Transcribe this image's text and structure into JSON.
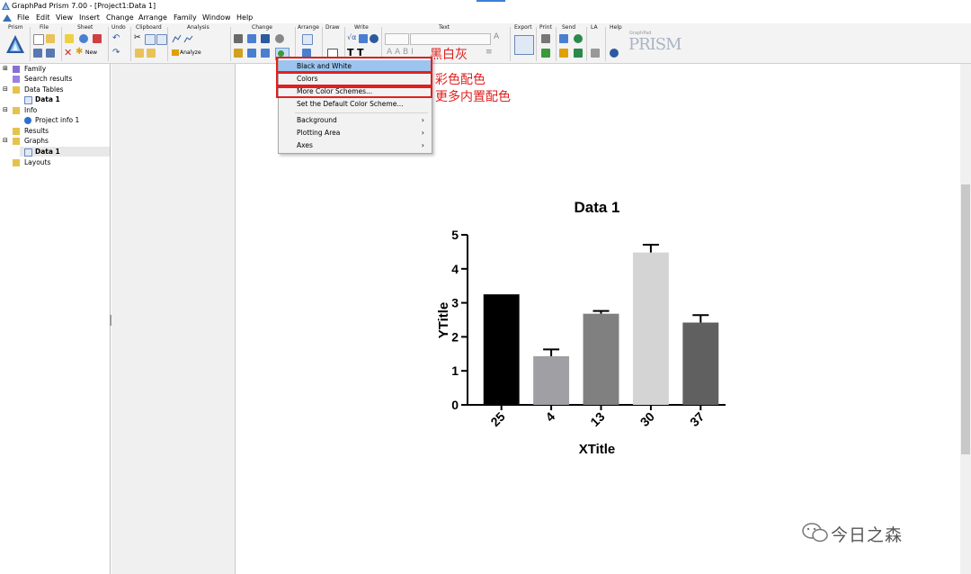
{
  "window": {
    "title": "GraphPad Prism 7.00 - [Project1:Data 1]"
  },
  "menubar": [
    "File",
    "Edit",
    "View",
    "Insert",
    "Change",
    "Arrange",
    "Family",
    "Window",
    "Help"
  ],
  "ribbon": {
    "groups": [
      "Prism",
      "File",
      "Sheet",
      "Undo",
      "Clipboard",
      "Analysis",
      "Change",
      "Arrange",
      "Draw",
      "Write",
      "Text",
      "Export",
      "Print",
      "Send",
      "LA",
      "Help"
    ],
    "new_label": "New",
    "analyze_label": "Analyze",
    "brand": "PRISM",
    "brand_small": "GraphPad"
  },
  "tree": {
    "items": [
      {
        "label": "Family",
        "icon": "family-icon"
      },
      {
        "label": "Search results",
        "icon": "search-results-icon"
      },
      {
        "label": "Data Tables",
        "icon": "folder-icon"
      },
      {
        "label": "Data 1",
        "icon": "data-table-icon"
      },
      {
        "label": "Info",
        "icon": "folder-icon"
      },
      {
        "label": "Project info 1",
        "icon": "info-icon"
      },
      {
        "label": "Results",
        "icon": "folder-icon"
      },
      {
        "label": "Graphs",
        "icon": "folder-icon"
      },
      {
        "label": "Data 1",
        "icon": "graph-icon"
      },
      {
        "label": "Layouts",
        "icon": "folder-icon"
      }
    ]
  },
  "color_menu": {
    "items": [
      {
        "label": "Black and White",
        "submenu": false
      },
      {
        "label": "Colors",
        "submenu": false
      },
      {
        "label": "More Color Schemes...",
        "submenu": false
      },
      {
        "label": "Set the Default Color Scheme...",
        "submenu": false
      },
      {
        "label": "Background",
        "submenu": true
      },
      {
        "label": "Plotting Area",
        "submenu": true
      },
      {
        "label": "Axes",
        "submenu": true
      }
    ],
    "highlighted": "Black and White"
  },
  "annotations": [
    "黑白灰",
    "彩色配色",
    "更多内置配色"
  ],
  "annotation_color": "#e02020",
  "chart_data": {
    "type": "bar",
    "title": "Data 1",
    "xlabel": "XTitle",
    "ylabel": "YTitle",
    "categories": [
      "25",
      "4",
      "13",
      "30",
      "37"
    ],
    "values": [
      3.25,
      1.43,
      2.68,
      4.48,
      2.42
    ],
    "errors": [
      0.0,
      0.2,
      0.08,
      0.23,
      0.22
    ],
    "ylim": [
      0,
      5
    ],
    "yticks": [
      "0",
      "1",
      "2",
      "3",
      "4",
      "5"
    ],
    "colors": [
      "#000000",
      "#a0a0a4",
      "#808080",
      "#d4d4d4",
      "#606060"
    ],
    "grid": false,
    "legend": "none"
  },
  "watermark": {
    "text": "今日之森",
    "icon": "wechat-icon"
  }
}
